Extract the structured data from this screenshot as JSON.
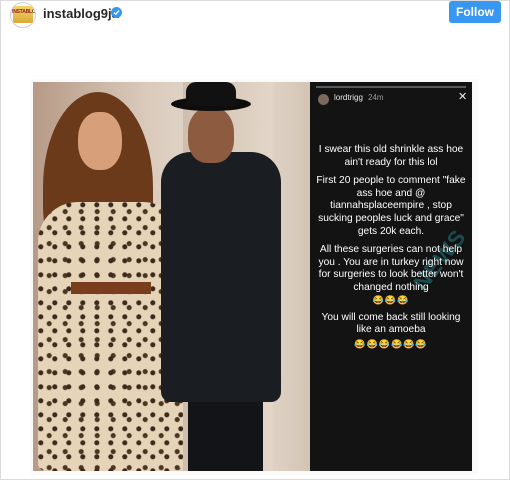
{
  "header": {
    "avatar_text": "INSTABLOG9JA",
    "username": "instablog9ja",
    "follow_label": "Follow"
  },
  "story": {
    "username": "lordtrigg",
    "time": "24m",
    "close": "✕",
    "watermark": "NEWS",
    "lines": [
      "I swear this old shrinkle ass hoe ain't ready for this lol",
      "First 20 people to comment \"fake ass hoe and @ tiannahsplaceempire , stop sucking peoples luck and grace\" gets 20k each.",
      "All these surgeries can not help you . You are in turkey right now for surgeries to look better won't changed nothing",
      "😂😂😂",
      "You will come back still looking like an amoeba",
      "😂😂😂😂😂😂"
    ]
  },
  "colors": {
    "follow_button": "#3897f0",
    "story_background": "#131313"
  },
  "icons": {
    "verified": "verified-badge-icon",
    "close": "close-icon"
  }
}
